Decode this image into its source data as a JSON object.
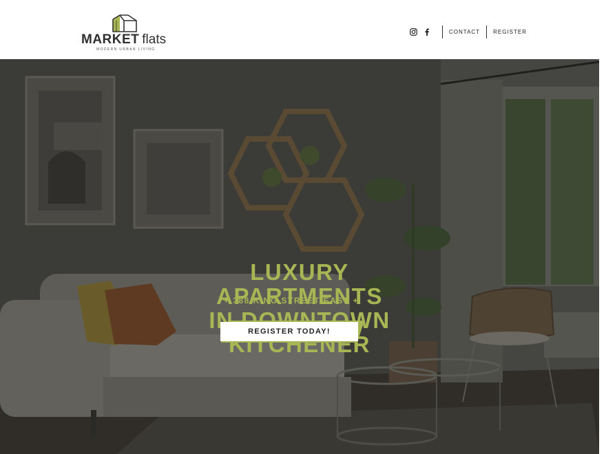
{
  "brand": {
    "name_bold": "MARKET",
    "name_light": "flats",
    "tagline": "MODERN URBAN LIVING",
    "accent_color": "#a9b654"
  },
  "nav": {
    "social": [
      {
        "icon": "instagram-icon"
      },
      {
        "icon": "facebook-icon"
      }
    ],
    "contact_label": "CONTACT",
    "register_label": "REGISTER"
  },
  "hero": {
    "headline_lines": [
      "LUXURY",
      "APARTMENTS",
      "IN DOWNTOWN",
      "KITCHENER"
    ],
    "address": "+ 388 KING STREET EAST +",
    "cta_label": "REGISTER TODAY!",
    "background": "living-room-photo"
  }
}
